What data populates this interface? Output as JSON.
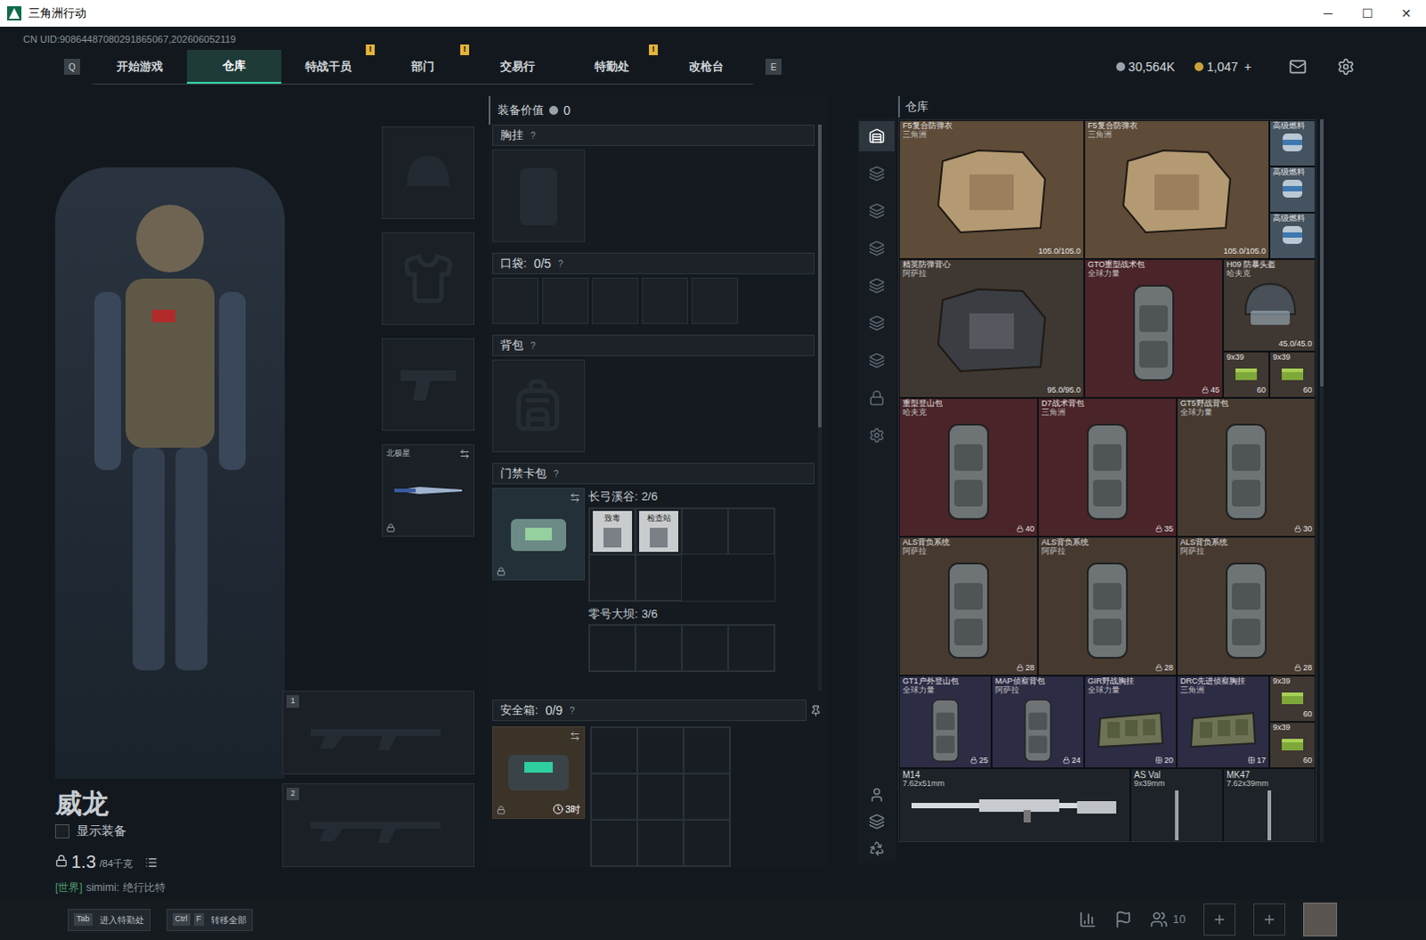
{
  "window": {
    "title": "三角洲行动",
    "controls": [
      "─",
      "☐",
      "✕"
    ]
  },
  "uid": "CN UID:90864487080291865067,202606052119",
  "nav": {
    "left_key": "Q",
    "right_key": "E",
    "alert_mark": "!",
    "tabs": [
      {
        "label": "开始游戏",
        "selected": false,
        "alert": false
      },
      {
        "label": "仓库",
        "selected": true,
        "alert": false
      },
      {
        "label": "特战干员",
        "selected": false,
        "alert": true
      },
      {
        "label": "部门",
        "selected": false,
        "alert": true
      },
      {
        "label": "交易行",
        "selected": false,
        "alert": false
      },
      {
        "label": "特勤处",
        "selected": false,
        "alert": true
      },
      {
        "label": "改枪台",
        "selected": false,
        "alert": false
      }
    ]
  },
  "currency": [
    {
      "amount": "30,564K",
      "kind": "coin",
      "plus": ""
    },
    {
      "amount": "1,047",
      "kind": "gold",
      "plus": "+"
    }
  ],
  "operator": {
    "name": "威龙",
    "show_equipment": {
      "label": "显示装备",
      "checked": false
    },
    "weight": "1.3",
    "weight_max": "/84千克",
    "chat": {
      "channel": "[世界]",
      "user": "simimi:",
      "message": "绝行比特"
    }
  },
  "slots": {
    "gear": [
      {
        "kind": "helmet",
        "label": "",
        "locked": false,
        "swap": false
      },
      {
        "kind": "armor",
        "label": "",
        "locked": false,
        "swap": false
      },
      {
        "kind": "pistol",
        "label": "",
        "locked": false,
        "swap": false
      },
      {
        "kind": "knife",
        "label": "北极星",
        "locked": true,
        "swap": true
      }
    ],
    "weapons": [
      {
        "index": "1"
      },
      {
        "index": "2"
      }
    ]
  },
  "loadout": {
    "value_label": "装备价值",
    "value": "0",
    "help": "?",
    "chest": {
      "label": "胸挂"
    },
    "pockets": {
      "label": "口袋:",
      "count": "0/5",
      "slots": 5
    },
    "backpack": {
      "label": "背包"
    },
    "keycard": {
      "label": "门禁卡包",
      "maps": [
        {
          "name": "长弓溪谷:",
          "count": "2/6",
          "cards": [
            {
              "label": "致毒"
            },
            {
              "label": "检查站"
            }
          ]
        },
        {
          "name": "零号大坝:",
          "count": "3/6",
          "cards": []
        }
      ]
    },
    "safe": {
      "label": "安全箱:",
      "count": "0/9",
      "timer": "3时"
    }
  },
  "warehouse": {
    "title": "仓库",
    "tabs": [
      {
        "selected": true
      },
      {
        "selected": false
      },
      {
        "selected": false
      },
      {
        "selected": false
      },
      {
        "selected": false
      },
      {
        "selected": false
      },
      {
        "selected": false
      },
      {
        "selected": false
      },
      {
        "selected": false
      }
    ],
    "items": [
      {
        "kind": "armor",
        "name": "F5复合防弹衣",
        "brand": "三角洲",
        "value": "105.0/105.0",
        "color": "#5e4b38"
      },
      {
        "kind": "armor",
        "name": "F5复合防弹衣",
        "brand": "三角洲",
        "value": "105.0/105.0",
        "color": "#5e4b38"
      },
      {
        "kind": "fuel",
        "name": "高级燃料",
        "brand": "",
        "value": "",
        "color": "#44535f"
      },
      {
        "kind": "fuel",
        "name": "高级燃料",
        "brand": "",
        "value": "",
        "color": "#44535f"
      },
      {
        "kind": "fuel",
        "name": "高级燃料",
        "brand": "",
        "value": "",
        "color": "#44535f"
      },
      {
        "kind": "vest",
        "name": "精英防弹背心",
        "brand": "阿萨拉",
        "value": "95.0/95.0",
        "color": "#3f3731"
      },
      {
        "kind": "backpack",
        "name": "GTO重型战术包",
        "brand": "全球力量",
        "value": "45",
        "color": "#4a2429"
      },
      {
        "kind": "helmet",
        "name": "H09 防暴头盔",
        "brand": "哈夫克",
        "value": "45.0/45.0",
        "color": "#3f3731"
      },
      {
        "kind": "ammo",
        "name": "9x39",
        "brand": "",
        "value": "60",
        "color": "#3f3731"
      },
      {
        "kind": "ammo",
        "name": "9x39",
        "brand": "",
        "value": "60",
        "color": "#3f3731"
      },
      {
        "kind": "backpack",
        "name": "重型登山包",
        "brand": "哈夫克",
        "value": "40",
        "color": "#4a2429"
      },
      {
        "kind": "backpack",
        "name": "D7战术背包",
        "brand": "三角洲",
        "value": "35",
        "color": "#4a2429"
      },
      {
        "kind": "backpack",
        "name": "GT5野战背包",
        "brand": "全球力量",
        "value": "30",
        "color": "#463a30"
      },
      {
        "kind": "backpack",
        "name": "ALS背负系统",
        "brand": "阿萨拉",
        "value": "28",
        "color": "#463a30"
      },
      {
        "kind": "backpack",
        "name": "ALS背负系统",
        "brand": "阿萨拉",
        "value": "28",
        "color": "#463a30"
      },
      {
        "kind": "backpack",
        "name": "ALS背负系统",
        "brand": "阿萨拉",
        "value": "28",
        "color": "#463a30"
      },
      {
        "kind": "smallpack",
        "name": "GT1户外登山包",
        "brand": "全球力量",
        "value": "25",
        "color": "#2d2c45"
      },
      {
        "kind": "smallpack",
        "name": "MAP侦察背包",
        "brand": "阿萨拉",
        "value": "24",
        "color": "#2d2c45"
      },
      {
        "kind": "rig",
        "name": "GIR野战胸挂",
        "brand": "全球力量",
        "value": "20",
        "color": "#2d2c45"
      },
      {
        "kind": "rig",
        "name": "DRC先进侦察胸挂",
        "brand": "三角洲",
        "value": "17",
        "color": "#2d2c45"
      },
      {
        "kind": "ammo",
        "name": "9x39",
        "brand": "",
        "value": "60",
        "color": "#3f3731"
      },
      {
        "kind": "ammo",
        "name": "9x39",
        "brand": "",
        "value": "60",
        "color": "#3f3731"
      },
      {
        "kind": "longrifle",
        "name": "M14",
        "brand": "7.62x51mm",
        "value": "",
        "color": "#1d2328"
      },
      {
        "kind": "rifle",
        "name": "AS Val",
        "brand": "9x39mm",
        "value": "",
        "color": "#1d2328"
      },
      {
        "kind": "rifle",
        "name": "MK47",
        "brand": "7.62x39mm",
        "value": "",
        "color": "#1d2328"
      }
    ]
  },
  "bottom": {
    "hints": [
      {
        "keys": [
          "Tab"
        ],
        "label": "进入特勤处"
      },
      {
        "keys": [
          "Ctrl",
          "F"
        ],
        "label": "转移全部"
      }
    ],
    "friends": "10"
  }
}
